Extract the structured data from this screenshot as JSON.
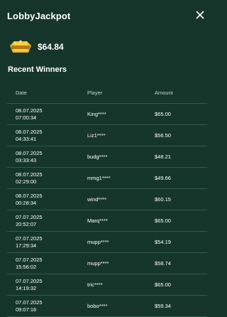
{
  "header": {
    "title": "LobbyJackpot",
    "close_icon": "close-icon"
  },
  "jackpot": {
    "amount": "$64.84",
    "badge_icon": "jackpot-badge-icon"
  },
  "recent_winners": {
    "title": "Recent Winners",
    "columns": {
      "date": "Date",
      "player": "Player",
      "amount": "Amount"
    },
    "rows": [
      {
        "date": "08.07.2025",
        "time": "07:00:34",
        "player": "King****",
        "amount": "$65.00"
      },
      {
        "date": "08.07.2025",
        "time": "04:33:41",
        "player": "Liz1****",
        "amount": "$56.50"
      },
      {
        "date": "08.07.2025",
        "time": "03:33:43",
        "player": "budg****",
        "amount": "$48.21"
      },
      {
        "date": "08.07.2025",
        "time": "02:29:00",
        "player": "mmg1****",
        "amount": "$49.66"
      },
      {
        "date": "08.07.2025",
        "time": "00:28:34",
        "player": "wind****",
        "amount": "$60.15"
      },
      {
        "date": "07.07.2025",
        "time": "20:52:07",
        "player": "Marq****",
        "amount": "$65.00"
      },
      {
        "date": "07.07.2025",
        "time": "17:29:34",
        "player": "mupp****",
        "amount": "$54.19"
      },
      {
        "date": "07.07.2025",
        "time": "15:56:02",
        "player": "mupp****",
        "amount": "$58.74"
      },
      {
        "date": "07.07.2025",
        "time": "14:19:32",
        "player": "tric****",
        "amount": "$65.00"
      },
      {
        "date": "07.07.2025",
        "time": "09:07:16",
        "player": "bobo****",
        "amount": "$59.34"
      }
    ]
  },
  "colors": {
    "background": "#17362b",
    "divider": "#2f5a4a",
    "badge_gold": "#e9b526"
  }
}
